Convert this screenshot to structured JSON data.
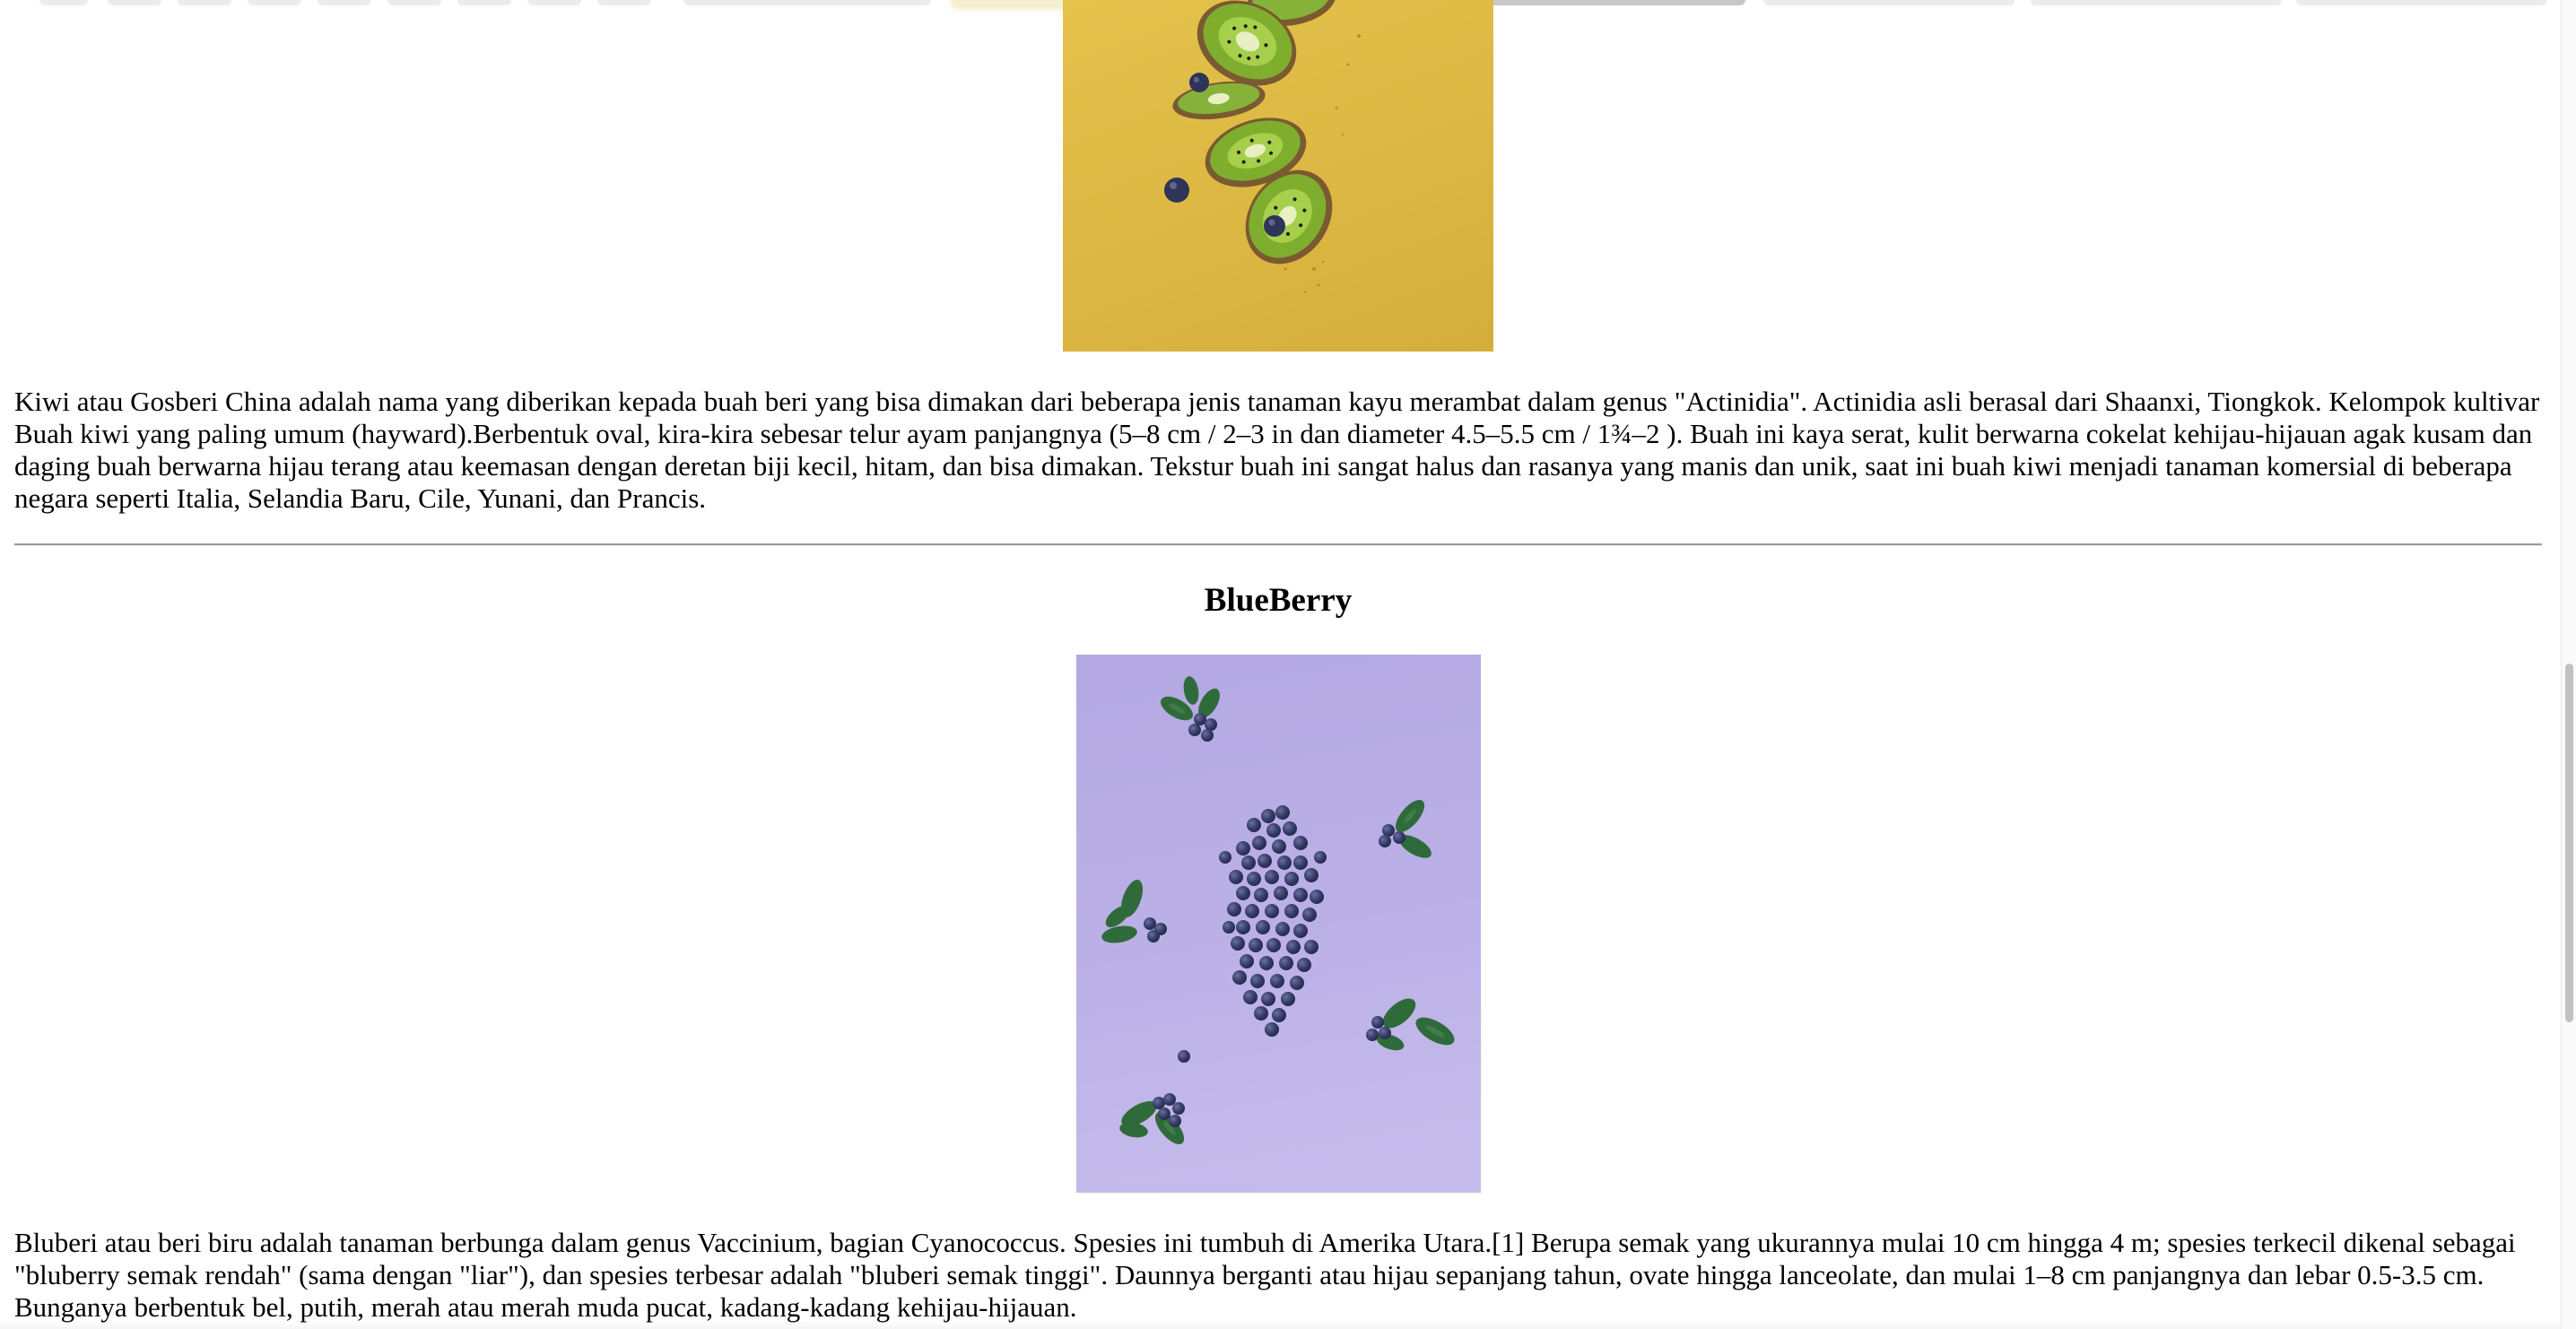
{
  "kiwi": {
    "image_alt": "Kiwi",
    "description": "Kiwi atau Gosberi China adalah nama yang diberikan kepada buah beri yang bisa dimakan dari beberapa jenis tanaman kayu merambat dalam genus \"Actinidia\". Actinidia asli berasal dari Shaanxi, Tiongkok. Kelompok kultivar Buah kiwi yang paling umum (hayward).Berbentuk oval, kira-kira sebesar telur ayam panjangnya (5–8 cm / 2–3 in dan diameter 4.5–5.5 cm / 1¾–2 ). Buah ini kaya serat, kulit berwarna cokelat kehijau-hijauan agak kusam dan daging buah berwarna hijau terang atau keemasan dengan deretan biji kecil, hitam, dan bisa dimakan. Tekstur buah ini sangat halus dan rasanya yang manis dan unik, saat ini buah kiwi menjadi tanaman komersial di beberapa negara seperti Italia, Selandia Baru, Cile, Yunani, dan Prancis."
  },
  "blueberry": {
    "heading": "BlueBerry",
    "image_alt": "BlueBerry",
    "description": "Bluberi atau beri biru adalah tanaman berbunga dalam genus Vaccinium, bagian Cyanococcus. Spesies ini tumbuh di Amerika Utara.[1] Berupa semak yang ukurannya mulai 10 cm hingga 4 m; spesies terkecil dikenal sebagai \"bluberry semak rendah\" (sama dengan \"liar\"), dan spesies terbesar adalah \"bluberi semak tinggi\". Daunnya berganti atau hijau sepanjang tahun, ovate hingga lanceolate, dan mulai 1–8 cm panjangnya dan lebar 0.5-3.5 cm. Bunganya berbentuk bel, putih, merah atau merah muda pucat, kadang-kadang kehijau-hijauan."
  },
  "colors": {
    "kiwi_background": "#dcb743",
    "blueberry_background": "#b8ade4",
    "kiwi_flesh": "#7fae2e",
    "blueberry_fruit": "#3a3f6b",
    "leaf": "#2f6b3a"
  }
}
